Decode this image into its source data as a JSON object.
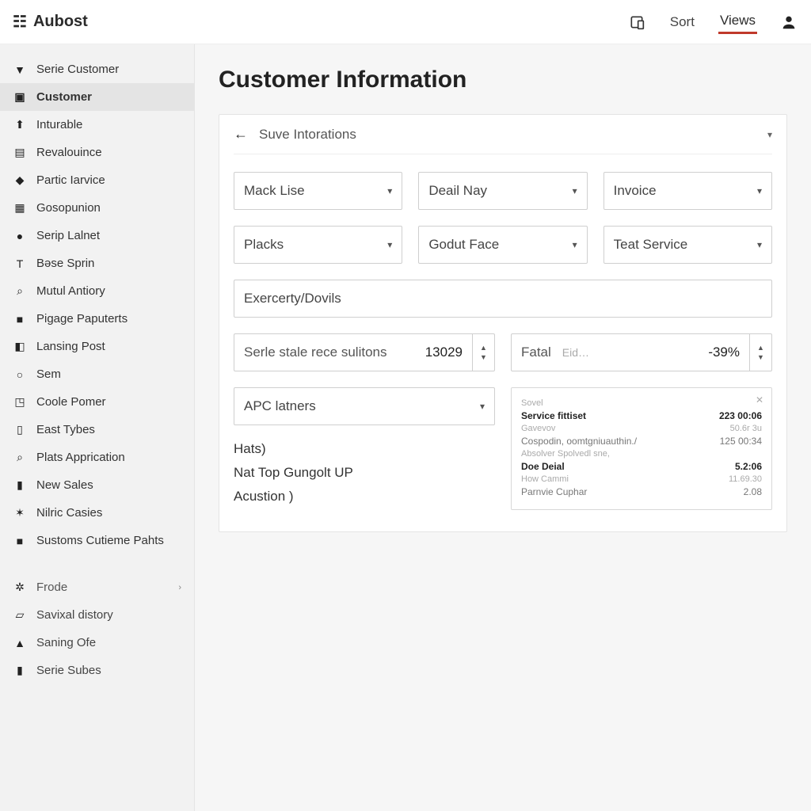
{
  "brand": "Aubost",
  "topbar": {
    "sort": "Sort",
    "views": "Views"
  },
  "sidebar": {
    "items": [
      {
        "icon": "▼",
        "label": "Serie Customer"
      },
      {
        "icon": "▣",
        "label": "Customer"
      },
      {
        "icon": "⬆",
        "label": "Inturable"
      },
      {
        "icon": "▤",
        "label": "Revalouince"
      },
      {
        "icon": "◆",
        "label": "Partic Iarvice"
      },
      {
        "icon": "▦",
        "label": "Gosopunion"
      },
      {
        "icon": "●",
        "label": "Serip Lalnet"
      },
      {
        "icon": "T",
        "label": "Bəse Sprin"
      },
      {
        "icon": "⌕",
        "label": "Mutul Antiory"
      },
      {
        "icon": "■",
        "label": "Pigage Paputerts"
      },
      {
        "icon": "◧",
        "label": "Lansing Post"
      },
      {
        "icon": "○",
        "label": "Sem"
      },
      {
        "icon": "◳",
        "label": "Coole Pomer"
      },
      {
        "icon": "▯",
        "label": "East Tybes"
      },
      {
        "icon": "⌕",
        "label": "Plats Apprication"
      },
      {
        "icon": "▮",
        "label": "New Sales"
      },
      {
        "icon": "✶",
        "label": "Nilric Casies"
      },
      {
        "icon": "■",
        "label": "Sustoms Cutieme Pahts"
      }
    ],
    "group": [
      {
        "icon": "✲",
        "label": "Frode"
      },
      {
        "icon": "▱",
        "label": "Savixal distory"
      },
      {
        "icon": "▲",
        "label": "Saning Ofe"
      },
      {
        "icon": "▮",
        "label": "Serie Subes"
      }
    ]
  },
  "page_title": "Customer Information",
  "card": {
    "head": "Suve Intorations",
    "selects": [
      "Mack Lise",
      "Deail Nay",
      "Invoice",
      "Placks",
      "Godut Face",
      "Teat Service"
    ],
    "input_full": "Exercerty/Dovils",
    "stepper_a": {
      "label": "Serle stale rece sulitons",
      "value": "13029"
    },
    "stepper_b": {
      "label": "Fatal",
      "mid": "Eid…",
      "value": "-39%"
    },
    "combo": "APC latners",
    "lines": [
      "Hats)",
      "Nat Top Gungolt UP",
      "Acustion )"
    ],
    "panel": {
      "head": "Sovel",
      "rows": [
        {
          "l": "Service fittiset",
          "r": "223 00:06"
        },
        {
          "l": "Gavevov",
          "r": "50.6r 3u"
        },
        {
          "l": "Cospodin, oomtgniuauthin./",
          "r": "125 00:34"
        },
        {
          "l": "Absolver Spolvedl sne,",
          "r": ""
        },
        {
          "l": "Doe Deial",
          "r": "5.2:06"
        },
        {
          "l": "How Cammi",
          "r": "11.69.30"
        },
        {
          "l": "Parnvie Cuphar",
          "r": "2.08"
        }
      ]
    }
  }
}
